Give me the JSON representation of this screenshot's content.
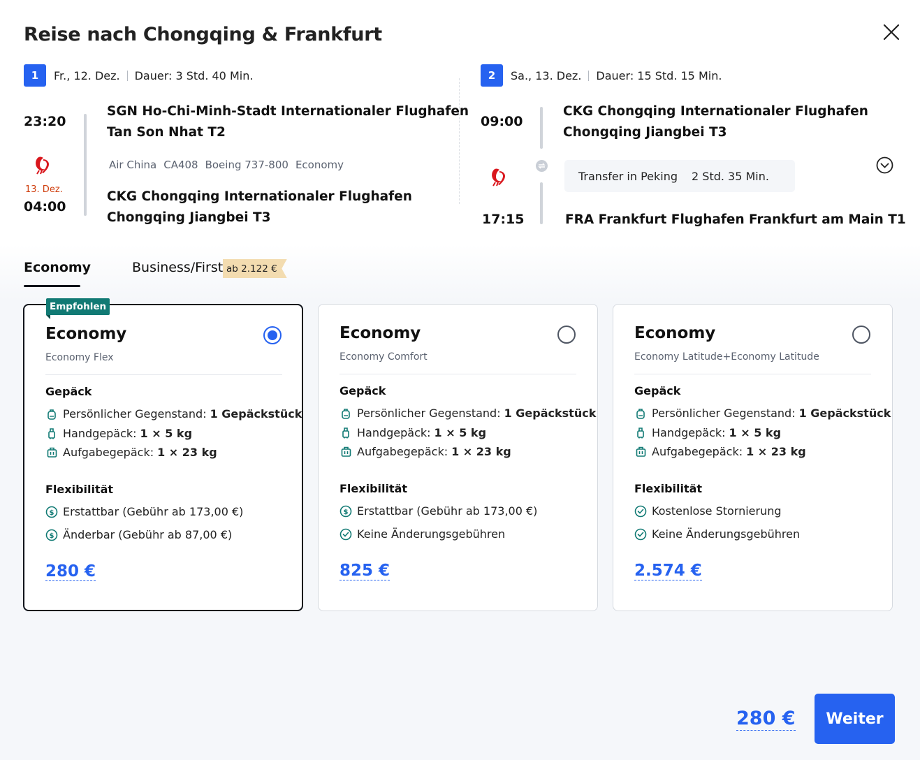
{
  "title": "Reise nach Chongqing & Frankfurt",
  "segments": [
    {
      "num": "1",
      "date": "Fr., 12. Dez.",
      "duration": "Dauer: 3 Std. 40 Min.",
      "dep_time": "23:20",
      "dep_airport_line1": "SGN Ho-Chi-Minh-Stadt Internationaler Flughafen",
      "dep_airport_line2": "Tan Son Nhat T2",
      "airline": "Air China",
      "flight_no": "CA408",
      "aircraft": "Boeing 737-800",
      "cabin": "Economy",
      "arr_date_note": "13. Dez.",
      "arr_time": "04:00",
      "arr_airport_line1": "CKG Chongqing Internationaler Flughafen",
      "arr_airport_line2": "Chongqing Jiangbei T3"
    },
    {
      "num": "2",
      "date": "Sa., 13. Dez.",
      "duration": "Dauer: 15 Std. 15 Min.",
      "dep_time": "09:00",
      "dep_airport_line1": "CKG Chongqing Internationaler Flughafen",
      "dep_airport_line2": "Chongqing Jiangbei T3",
      "transfer_label": "Transfer in Peking",
      "transfer_duration": "2 Std. 35 Min.",
      "arr_time": "17:15",
      "arr_airport_line1": "FRA Frankfurt Flughafen Frankfurt am Main T1"
    }
  ],
  "tabs": {
    "economy": "Economy",
    "business": "Business/First",
    "business_price": "ab 2.122 €"
  },
  "cards": [
    {
      "badge": "Empfohlen",
      "title": "Economy",
      "subtitle": "Economy Flex",
      "baggage_heading": "Gepäck",
      "bag1_label": "Persönlicher Gegenstand:",
      "bag1_value": "1 Gepäckstück",
      "bag2_label": "Handgepäck:",
      "bag2_value": "1 × 5 kg",
      "bag3_label": "Aufgabegepäck:",
      "bag3_value": "1 × 23 kg",
      "flex_heading": "Flexibilität",
      "flex1": "Erstattbar (Gebühr ab 173,00 €)",
      "flex2": "Änderbar (Gebühr ab 87,00 €)",
      "price": "280 €",
      "selected": true
    },
    {
      "title": "Economy",
      "subtitle": "Economy Comfort",
      "baggage_heading": "Gepäck",
      "bag1_label": "Persönlicher Gegenstand:",
      "bag1_value": "1 Gepäckstück",
      "bag2_label": "Handgepäck:",
      "bag2_value": "1 × 5 kg",
      "bag3_label": "Aufgabegepäck:",
      "bag3_value": "1 × 23 kg",
      "flex_heading": "Flexibilität",
      "flex1": "Erstattbar (Gebühr ab 173,00 €)",
      "flex2": "Keine Änderungsgebühren",
      "price": "825 €",
      "selected": false
    },
    {
      "title": "Economy",
      "subtitle": "Economy Latitude+Economy Latitude",
      "baggage_heading": "Gepäck",
      "bag1_label": "Persönlicher Gegenstand:",
      "bag1_value": "1 Gepäckstück",
      "bag2_label": "Handgepäck:",
      "bag2_value": "1 × 5 kg",
      "bag3_label": "Aufgabegepäck:",
      "bag3_value": "1 × 23 kg",
      "flex_heading": "Flexibilität",
      "flex1": "Kostenlose Stornierung",
      "flex2": "Keine Änderungsgebühren",
      "price": "2.574 €",
      "selected": false
    }
  ],
  "footer": {
    "total": "280 €",
    "continue_label": "Weiter"
  },
  "colors": {
    "accent": "#2662f0",
    "badge": "#117a74",
    "date_warning": "#d04010",
    "price_tag": "#f3dcb0"
  },
  "icons": {
    "close": "close-icon",
    "airline": "air-china-logo-icon",
    "expand": "chevron-down-circle-icon",
    "transfer": "transfer-icon",
    "personal_item": "backpack-icon",
    "carry_on": "carry-on-bag-icon",
    "checked": "suitcase-icon",
    "refund": "dollar-circle-icon",
    "check": "check-circle-icon"
  }
}
